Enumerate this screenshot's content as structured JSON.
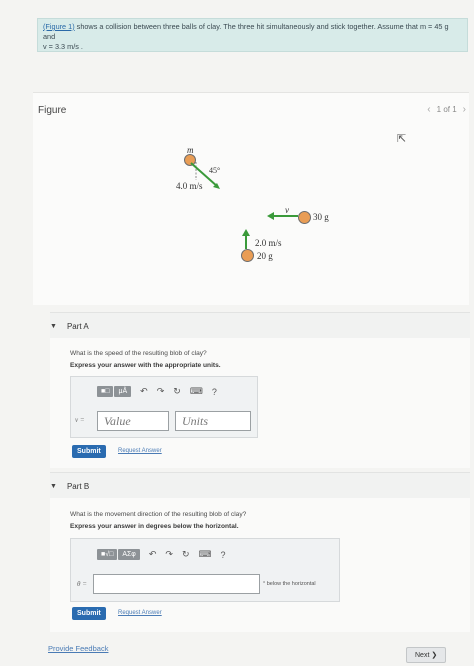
{
  "problem": {
    "link_text": "(Figure 1)",
    "text": " shows a collision between three balls of clay. The three hit simultaneously and stick together. Assume that m = 45 g and",
    "text2": "v = 3.3 m/s ."
  },
  "figure": {
    "label": "Figure",
    "pager": "1 of 1",
    "prev_icon": "‹",
    "next_icon": "›",
    "diagram": {
      "ball_m_label": "m",
      "angle_label": "45°",
      "speed_m": "4.0 m/s",
      "v_label": "v",
      "mass_30": "30 g",
      "speed_20": "2.0 m/s",
      "mass_20": "20 g"
    }
  },
  "part_a": {
    "title": "Part A",
    "question": "What is the speed of the resulting blob of clay?",
    "instruction": "Express your answer with the appropriate units.",
    "var_label": "v =",
    "value_placeholder": "Value",
    "units_placeholder": "Units",
    "tool_templates": "■□",
    "tool_units": "μÅ",
    "help": "?",
    "submit": "Submit",
    "request": "Request Answer"
  },
  "part_b": {
    "title": "Part B",
    "question": "What is the movement direction of the resulting blob of clay?",
    "instruction": "Express your answer in degrees below the horizontal.",
    "var_label": "θ =",
    "suffix": "° below the horizontal",
    "tool_templates": "■√□",
    "tool_greek": "ΑΣφ",
    "help": "?",
    "submit": "Submit",
    "request": "Request Answer"
  },
  "footer": {
    "feedback": "Provide Feedback",
    "next": "Next",
    "next_icon": "❯"
  },
  "colors": {
    "header_bg": "#d8ebe9",
    "ball": "#e99d55",
    "arrow": "#3a9a3a",
    "submit": "#2a6bb0"
  }
}
